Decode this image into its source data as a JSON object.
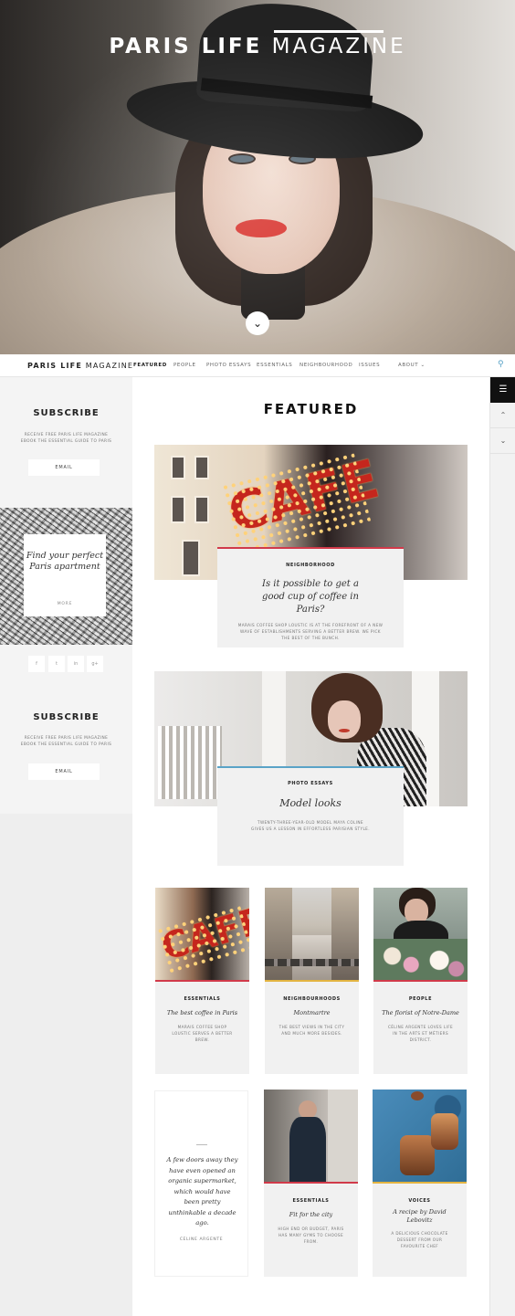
{
  "hero": {
    "title_bold": "PARIS LIFE",
    "title_light": "MAGAZINE",
    "scroll_icon": "chevron-down-icon"
  },
  "nav": {
    "logo_bold": "PARIS LIFE",
    "logo_light": "MAGAZINE",
    "items": [
      "FEATURED",
      "PEOPLE",
      "PHOTO ESSAYS",
      "ESSENTIALS",
      "NEIGHBOURHOOD",
      "ISSUES",
      "ABOUT"
    ],
    "active": "FEATURED",
    "search_icon": "search-icon",
    "accent": "#5aa3c7"
  },
  "sidebar": {
    "subscribe1": {
      "title": "SUBSCRIBE",
      "text": "RECEIVE FREE PARIS LIFE MAGAZINE EBOOK THE ESSENTIAL GUIDE TO PARIS",
      "button": "EMAIL"
    },
    "promo": {
      "text": "Find your perfect Paris apartment",
      "more": "MORE"
    },
    "social": [
      "f",
      "t",
      "in",
      "g+"
    ],
    "subscribe2": {
      "title": "SUBSCRIBE",
      "text": "RECEIVE FREE PARIS LIFE MAGAZINE EBOOK THE ESSENTIAL GUIDE TO PARIS",
      "button": "EMAIL"
    }
  },
  "rail": {
    "menu_icon": "hamburger-icon",
    "up_icon": "chevron-up-icon",
    "down_icon": "chevron-down-icon"
  },
  "main": {
    "section_title": "FEATURED",
    "big_articles": [
      {
        "category": "NEIGHBORHOOD",
        "headline": "Is it possible to get a good cup of coffee in Paris?",
        "desc": "MARAIS COFFEE SHOP LOUSTIC IS AT THE FOREFRONT OF A NEW WAVE OF ESTABLISHMENTS SERVING A BETTER BREW. WE PICK THE BEST OF THE BUNCH.",
        "accent": "#d13a4a"
      },
      {
        "category": "PHOTO ESSAYS",
        "headline": "Model looks",
        "desc": "TWENTY-THREE-YEAR-OLD MODEL MAYA COLINE GIVES US A LESSON IN EFFORTLESS PARISIAN STYLE.",
        "accent": "#5aa3c7"
      }
    ],
    "small_articles": [
      {
        "category": "ESSENTIALS",
        "headline": "The best coffee in Paris",
        "desc": "MARAIS COFFEE SHOP LOUSTIC SERVES A BETTER BREW."
      },
      {
        "category": "NEIGHBOURHOODS",
        "headline": "Montmartre",
        "desc": "THE BEST VIEWS IN THE CITY AND MUCH MORE BESIDES."
      },
      {
        "category": "PEOPLE",
        "headline": "The florist of Notre-Dame",
        "desc": "CÉLINE ARGENTE LOVES LIFE IN THE ARTS ET MÉTIERS DISTRICT."
      },
      {
        "category": "ESSENTIALS",
        "headline": "Fit for the city",
        "desc": "HIGH END OR BUDGET, PARIS HAS MANY GYMS TO CHOOSE FROM."
      },
      {
        "category": "VOICES",
        "headline": "A recipe by David Lebovitz",
        "desc": "A DELICIOUS CHOCOLATE DESSERT FROM OUR FAVOURITE CHEF"
      }
    ],
    "quote": {
      "text": "A few doors away they have even opened an organic supermarket, which would have been pretty unthinkable a decade ago.",
      "author": "CELINE ARGENTE"
    }
  }
}
